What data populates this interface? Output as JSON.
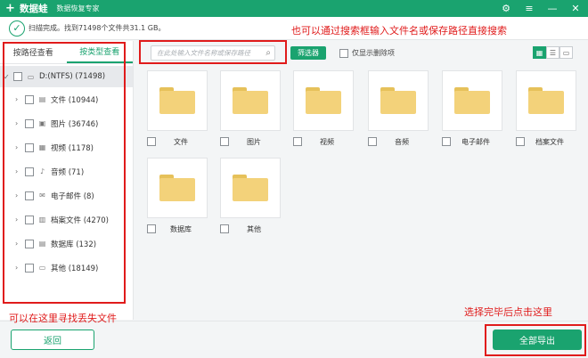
{
  "titlebar": {
    "logo_glyph": "+",
    "app_name": "数据蛙",
    "app_subtitle": "数据恢复专家",
    "controls": {
      "settings": "⚙",
      "menu": "≡",
      "minimize": "—",
      "close": "✕"
    }
  },
  "status": {
    "text": "扫描完成。找到71498个文件共31.1 GB。"
  },
  "left_panel": {
    "tabs": [
      {
        "label": "按路径查看",
        "active": false
      },
      {
        "label": "按类型查看",
        "active": true
      }
    ],
    "root": {
      "label": "D:(NTFS) (71498)"
    },
    "items": [
      {
        "label": "文件 (10944)",
        "icon": "document-icon"
      },
      {
        "label": "图片 (36746)",
        "icon": "image-icon"
      },
      {
        "label": "视频 (1178)",
        "icon": "video-icon"
      },
      {
        "label": "音频 (71)",
        "icon": "audio-icon"
      },
      {
        "label": "电子邮件 (8)",
        "icon": "email-icon"
      },
      {
        "label": "档案文件 (4270)",
        "icon": "archive-icon"
      },
      {
        "label": "数据库 (132)",
        "icon": "database-icon"
      },
      {
        "label": "其他 (18149)",
        "icon": "folder-icon"
      }
    ]
  },
  "toolbar": {
    "search_placeholder": "在此处输入文件名称或保存路径",
    "filter_label": "筛选器",
    "only_deleted_label": "仅显示删除项"
  },
  "grid": {
    "tiles": [
      {
        "label": "文件"
      },
      {
        "label": "图片"
      },
      {
        "label": "视频"
      },
      {
        "label": "音频"
      },
      {
        "label": "电子邮件"
      },
      {
        "label": "档案文件"
      },
      {
        "label": "数据库"
      },
      {
        "label": "其他"
      }
    ]
  },
  "annotations": {
    "search_hint": "也可以通过搜索框输入文件名或保存路径直接搜索",
    "left_hint": "可以在这里寻找丢失文件",
    "export_hint": "选择完毕后点击这里"
  },
  "bottom": {
    "back_label": "返回",
    "export_label": "全部导出"
  },
  "colors": {
    "accent": "#1aa36f",
    "annotation": "#e01b1b",
    "folder": "#f3d27a"
  }
}
